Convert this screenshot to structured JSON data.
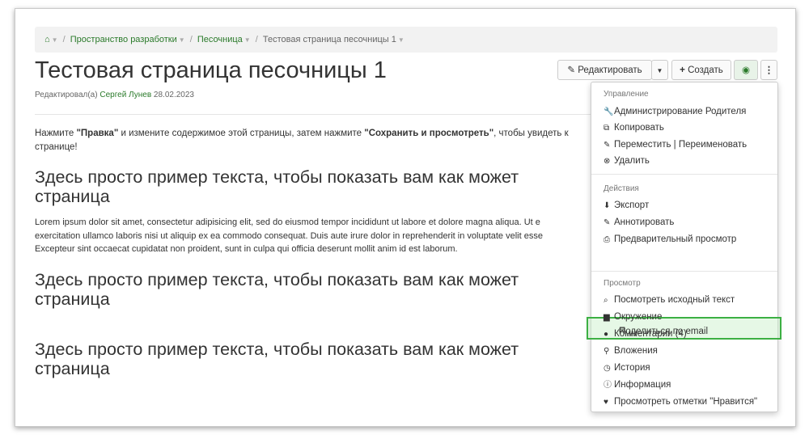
{
  "breadcrumb": {
    "home": "⌂",
    "items": [
      "Пространство разработки",
      "Песочница"
    ],
    "current": "Тестовая страница песочницы 1"
  },
  "page": {
    "title": "Тестовая страница песочницы 1",
    "edited_prefix": "Редактировал(а)",
    "author": "Сергей Лунев",
    "date": "28.02.2023"
  },
  "toolbar": {
    "edit_label": "Редактировать",
    "create_label": "Создать"
  },
  "content": {
    "intro_1": "Нажмите ",
    "intro_b1": "\"Правка\"",
    "intro_2": " и измените содержимое этой страницы, затем нажмите ",
    "intro_b2": "\"Сохранить и просмотреть\"",
    "intro_3": ", чтобы увидеть к",
    "intro_line2": "странице!",
    "heading_line1": "Здесь просто пример текста, чтобы показать вам как может",
    "heading_line2": "страница",
    "lorem": [
      "Lorem ipsum dolor sit amet, consectetur adipisicing elit, sed do eiusmod tempor incididunt ut labore et dolore magna aliqua. Ut e",
      "exercitation ullamco laboris nisi ut aliquip ex ea commodo consequat. Duis aute irure dolor in reprehenderit in voluptate velit esse",
      "Excepteur sint occaecat cupidatat non proident, sunt in culpa qui officia deserunt mollit anim id est laborum."
    ]
  },
  "menu": {
    "sections": [
      "Управление",
      "Действия",
      "Просмотр"
    ],
    "manage": [
      "Администрирование Родителя",
      "Копировать",
      "Переместить | Переименовать",
      "Удалить"
    ],
    "actions": [
      "Экспорт",
      "Аннотировать",
      "Предварительный просмотр",
      "Поделиться по email"
    ],
    "view": [
      "Посмотреть исходный текст",
      "Окружение",
      "Комментарии (4)",
      "Вложения",
      "История",
      "Информация",
      "Просмотреть отметки \"Нравится\""
    ]
  },
  "colors": {
    "link": "#2a7a2a",
    "highlight_border": "#3cb043"
  }
}
